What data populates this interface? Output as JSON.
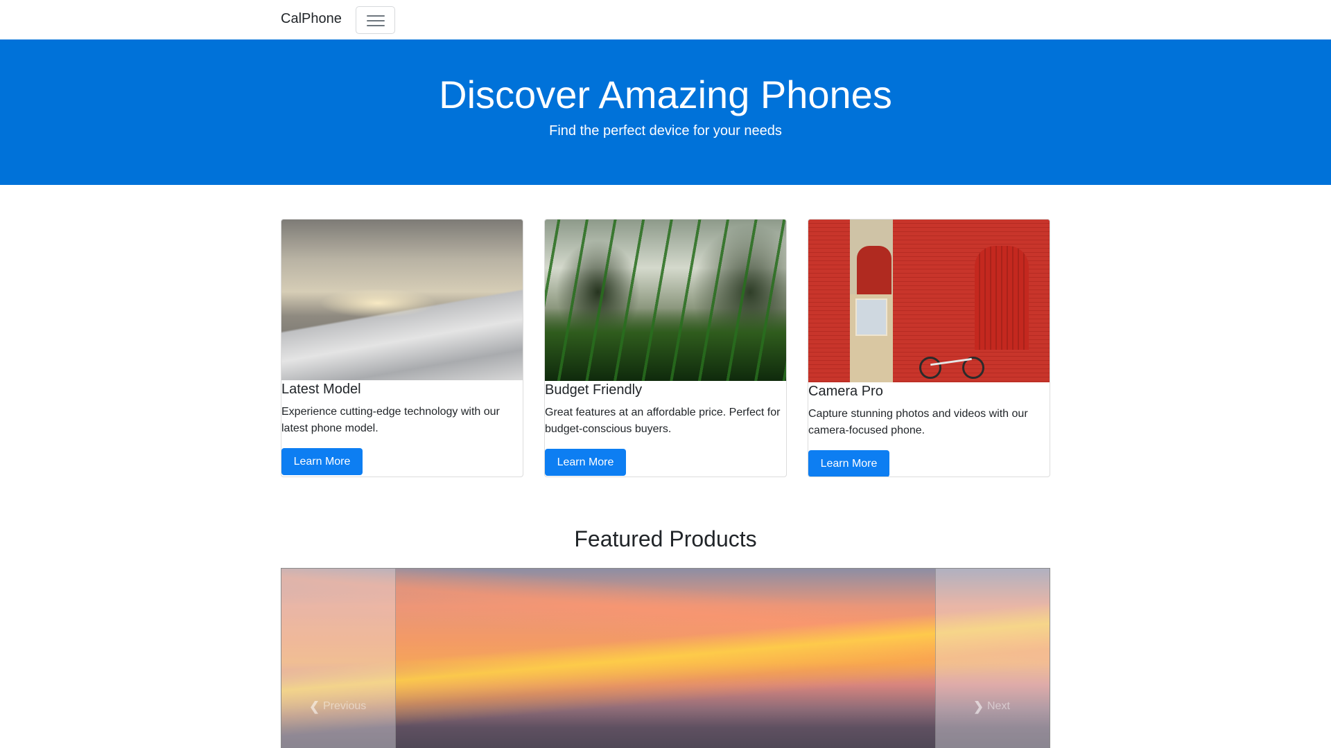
{
  "navbar": {
    "brand": "CalPhone",
    "toggler_icon": "hamburger-menu-icon"
  },
  "hero": {
    "title": "Discover Amazing Phones",
    "subtitle": "Find the perfect device for your needs",
    "background_color": "#0072d9"
  },
  "cards": [
    {
      "title": "Latest Model",
      "description": "Experience cutting-edge technology with our latest phone model.",
      "button_label": "Learn More"
    },
    {
      "title": "Budget Friendly",
      "description": "Great features at an affordable price. Perfect for budget-conscious buyers.",
      "button_label": "Learn More"
    },
    {
      "title": "Camera Pro",
      "description": "Capture stunning photos and videos with our camera-focused phone.",
      "button_label": "Learn More"
    }
  ],
  "featured": {
    "title": "Featured Products",
    "carousel": {
      "prev_label": "Previous",
      "next_label": "Next",
      "prev_icon": "chevron-left-icon",
      "next_icon": "chevron-right-icon"
    }
  },
  "colors": {
    "button": "#0d7ef2",
    "text": "#212529"
  }
}
